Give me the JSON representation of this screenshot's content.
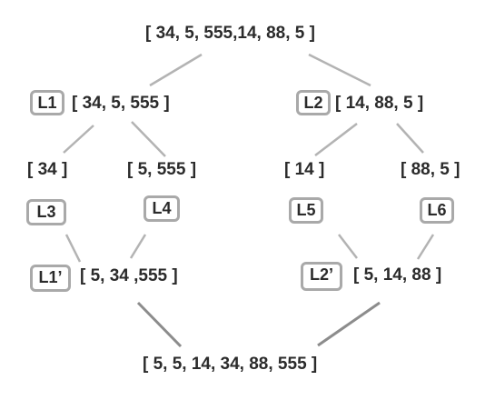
{
  "arrays": {
    "root": "[ 34, 5, 555,14, 88, 5 ]",
    "l1": "[ 34, 5, 555 ]",
    "l2": "[ 14, 88, 5 ]",
    "l3": "[ 34 ]",
    "l4": "[ 5, 555 ]",
    "l5": "[ 14 ]",
    "l6": "[ 88, 5 ]",
    "l1_merged": "[ 5, 34 ,555 ]",
    "l2_merged": "[ 5, 14, 88 ]",
    "final": "[ 5, 5, 14, 34, 88, 555 ]"
  },
  "labels": {
    "l1": "L1",
    "l2": "L2",
    "l3": "L3",
    "l4": "L4",
    "l5": "L5",
    "l6": "L6",
    "l1_merged": "L1’",
    "l2_merged": "L2’"
  },
  "colors": {
    "text": "#2b2b2b",
    "badge_border": "#a9a9a9",
    "edge": "#b3b3b3"
  }
}
